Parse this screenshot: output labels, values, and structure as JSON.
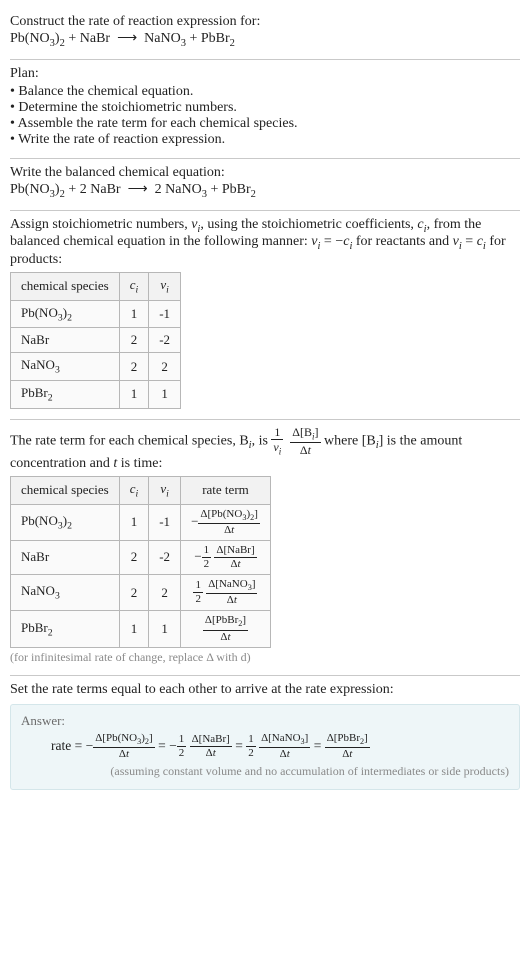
{
  "intro": {
    "line1": "Construct the rate of reaction expression for:",
    "eqn_unbalanced_html": "Pb(NO<sub>3</sub>)<sub>2</sub> + NaBr &nbsp;⟶&nbsp; NaNO<sub>3</sub> + PbBr<sub>2</sub>"
  },
  "plan": {
    "title": "Plan:",
    "items": [
      "Balance the chemical equation.",
      "Determine the stoichiometric numbers.",
      "Assemble the rate term for each chemical species.",
      "Write the rate of reaction expression."
    ]
  },
  "balanced": {
    "line1": "Write the balanced chemical equation:",
    "eqn_html": "Pb(NO<sub>3</sub>)<sub>2</sub> + 2 NaBr &nbsp;⟶&nbsp; 2 NaNO<sub>3</sub> + PbBr<sub>2</sub>"
  },
  "stoich": {
    "intro_html": "Assign stoichiometric numbers, <span class='it'>&nu;<sub>i</sub></span>, using the stoichiometric coefficients, <span class='it'>c<sub>i</sub></span>, from the balanced chemical equation in the following manner: <span class='it'>&nu;<sub>i</sub></span> = &minus;<span class='it'>c<sub>i</sub></span> for reactants and <span class='it'>&nu;<sub>i</sub></span> = <span class='it'>c<sub>i</sub></span> for products:",
    "headers": [
      "chemical species",
      "c_i",
      "nu_i"
    ],
    "rows": [
      {
        "species_html": "Pb(NO<sub>3</sub>)<sub>2</sub>",
        "c": "1",
        "nu": "-1"
      },
      {
        "species_html": "NaBr",
        "c": "2",
        "nu": "-2"
      },
      {
        "species_html": "NaNO<sub>3</sub>",
        "c": "2",
        "nu": "2"
      },
      {
        "species_html": "PbBr<sub>2</sub>",
        "c": "1",
        "nu": "1"
      }
    ]
  },
  "rateterm": {
    "intro_pre": "The rate term for each chemical species, B",
    "intro_mid": ", is ",
    "intro_post_html": " where [B<span class='it'><sub>i</sub></span>] is the amount concentration and <span class='it'>t</span> is time:",
    "headers": [
      "chemical species",
      "c_i",
      "nu_i",
      "rate term"
    ],
    "rows": [
      {
        "species_html": "Pb(NO<sub>3</sub>)<sub>2</sub>",
        "c": "1",
        "nu": "-1",
        "rate_html": "&minus;<span class='sfrac'><span class='num'>&Delta;[Pb(NO<sub>3</sub>)<sub>2</sub>]</span><span class='den'>&Delta;<span class='it'>t</span></span></span>"
      },
      {
        "species_html": "NaBr",
        "c": "2",
        "nu": "-2",
        "rate_html": "&minus;<span class='sfrac'><span class='num'>1</span><span class='den'>2</span></span>&nbsp;<span class='sfrac'><span class='num'>&Delta;[NaBr]</span><span class='den'>&Delta;<span class='it'>t</span></span></span>"
      },
      {
        "species_html": "NaNO<sub>3</sub>",
        "c": "2",
        "nu": "2",
        "rate_html": "<span class='sfrac'><span class='num'>1</span><span class='den'>2</span></span>&nbsp;<span class='sfrac'><span class='num'>&Delta;[NaNO<sub>3</sub>]</span><span class='den'>&Delta;<span class='it'>t</span></span></span>"
      },
      {
        "species_html": "PbBr<sub>2</sub>",
        "c": "1",
        "nu": "1",
        "rate_html": "<span class='sfrac'><span class='num'>&Delta;[PbBr<sub>2</sub>]</span><span class='den'>&Delta;<span class='it'>t</span></span></span>"
      }
    ],
    "note": "(for infinitesimal rate of change, replace &Delta; with d)"
  },
  "final": {
    "intro": "Set the rate terms equal to each other to arrive at the rate expression:",
    "answer_label": "Answer:",
    "rate_html": "rate = &minus;<span class='sfrac'><span class='num'>&Delta;[Pb(NO<sub>3</sub>)<sub>2</sub>]</span><span class='den'>&Delta;<span class='it'>t</span></span></span> = &minus;<span class='sfrac'><span class='num'>1</span><span class='den'>2</span></span>&nbsp;<span class='sfrac'><span class='num'>&Delta;[NaBr]</span><span class='den'>&Delta;<span class='it'>t</span></span></span> = <span class='sfrac'><span class='num'>1</span><span class='den'>2</span></span>&nbsp;<span class='sfrac'><span class='num'>&Delta;[NaNO<sub>3</sub>]</span><span class='den'>&Delta;<span class='it'>t</span></span></span> = <span class='sfrac'><span class='num'>&Delta;[PbBr<sub>2</sub>]</span><span class='den'>&Delta;<span class='it'>t</span></span></span>",
    "note": "(assuming constant volume and no accumulation of intermediates or side products)"
  }
}
